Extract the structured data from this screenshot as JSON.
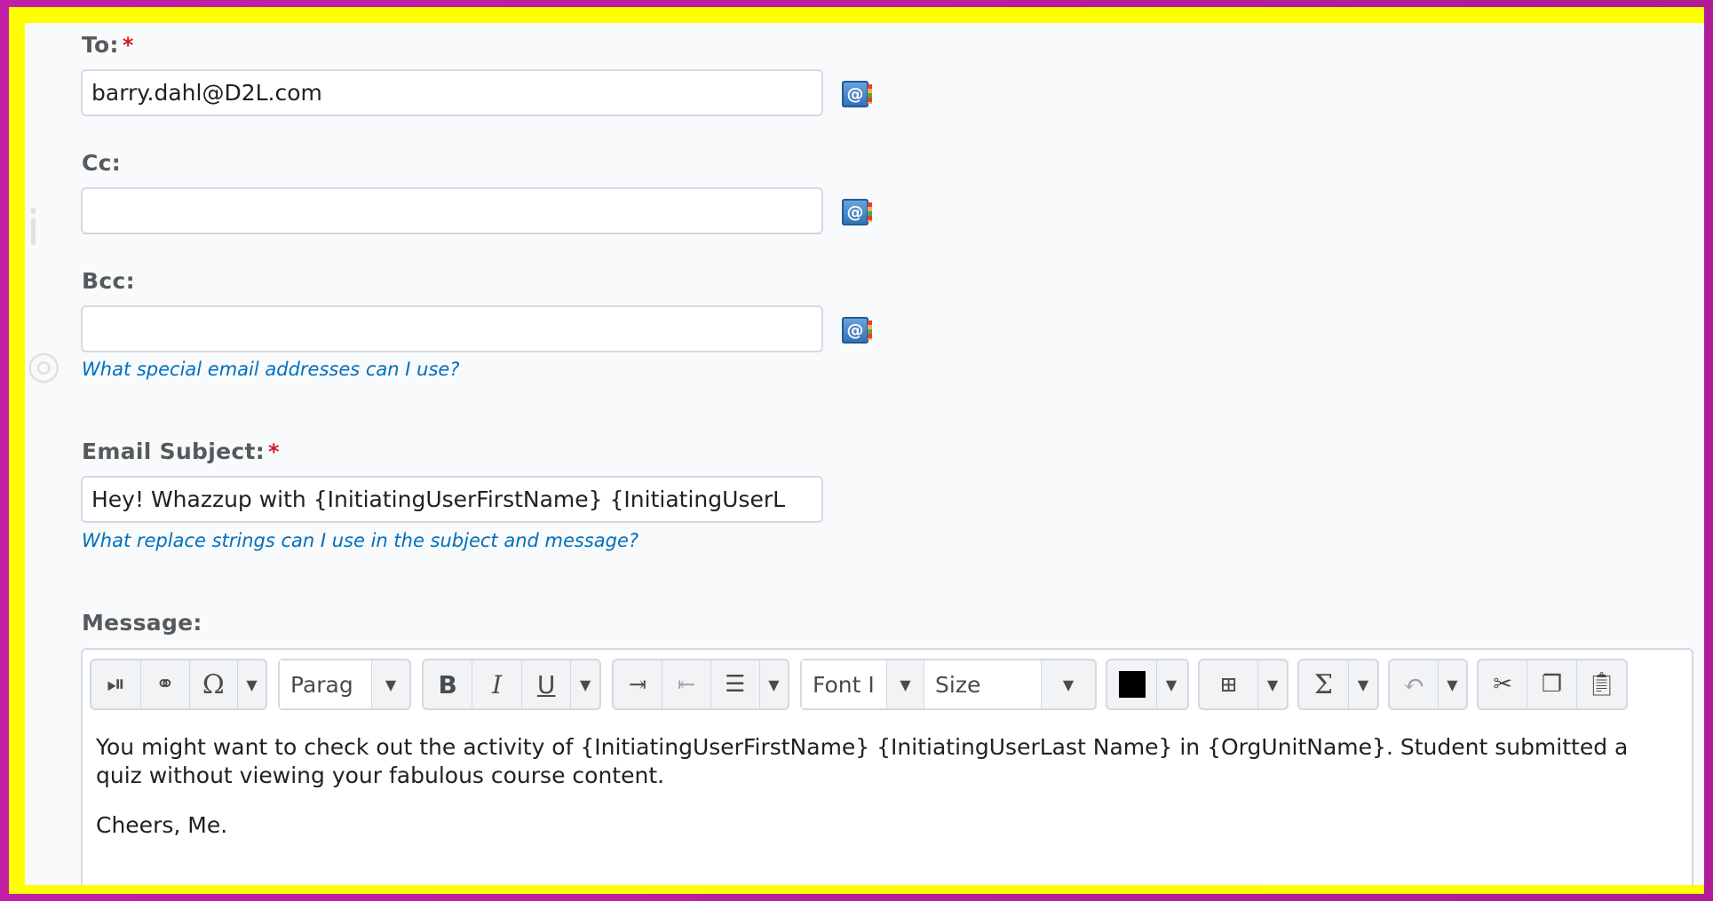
{
  "form": {
    "to": {
      "label": "To:",
      "required_mark": "*",
      "value": "barry.dahl@D2L.com"
    },
    "cc": {
      "label": "Cc:",
      "value": ""
    },
    "bcc": {
      "label": "Bcc:",
      "value": ""
    },
    "special_addresses_help": "What special email addresses can I use?",
    "subject": {
      "label": "Email Subject:",
      "required_mark": "*",
      "value": "Hey! Whazzup with {InitiatingUserFirstName} {InitiatingUserL"
    },
    "replace_strings_help": "What replace strings can I use in the subject and message?",
    "message_label": "Message:"
  },
  "address_book_icon_glyph": "@",
  "toolbar": {
    "paragraph_label": "Parag",
    "font_label": "Font I",
    "size_label": "Size",
    "bold_label": "B",
    "italic_label": "I",
    "underline_label": "U",
    "omega_label": "Ω",
    "sigma_label": "Σ",
    "icons": [
      "insert-stuff-icon",
      "insert-quicklink-icon",
      "special-character-icon",
      "paragraph-format-dropdown",
      "bold-icon",
      "italic-icon",
      "underline-icon",
      "indent-icon",
      "outdent-icon",
      "bullet-list-icon",
      "font-family-dropdown",
      "font-size-dropdown",
      "text-color-icon",
      "insert-table-icon",
      "equation-icon",
      "undo-icon",
      "cut-icon",
      "copy-icon",
      "paste-icon"
    ],
    "text_color": "#000000"
  },
  "message": {
    "paragraph_1": "You might want to check out the activity of {InitiatingUserFirstName} {InitiatingUserLast Name} in {OrgUnitName}. Student submitted a quiz without viewing your fabulous course content.",
    "paragraph_2": "Cheers, Me."
  },
  "colors": {
    "frame": "#ffff00",
    "background": "#c21fa6",
    "required": "#cd2026",
    "link": "#006fbf"
  }
}
